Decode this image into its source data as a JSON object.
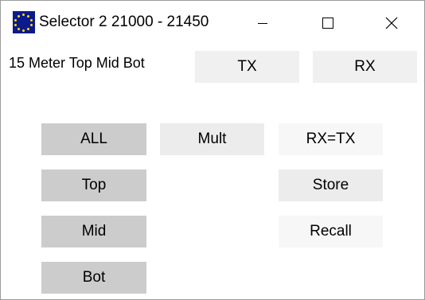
{
  "window": {
    "title": "Selector 2 21000 - 21450"
  },
  "band_label": "15 Meter Top Mid Bot",
  "buttons": {
    "tx": "TX",
    "rx": "RX",
    "all": "ALL",
    "mult": "Mult",
    "rx_eq_tx": "RX=TX",
    "top": "Top",
    "store": "Store",
    "mid": "Mid",
    "recall": "Recall",
    "bot": "Bot"
  },
  "icons": {
    "app": "eu-flag-icon",
    "minimize": "minimize-icon",
    "maximize": "maximize-icon",
    "close": "close-icon"
  }
}
